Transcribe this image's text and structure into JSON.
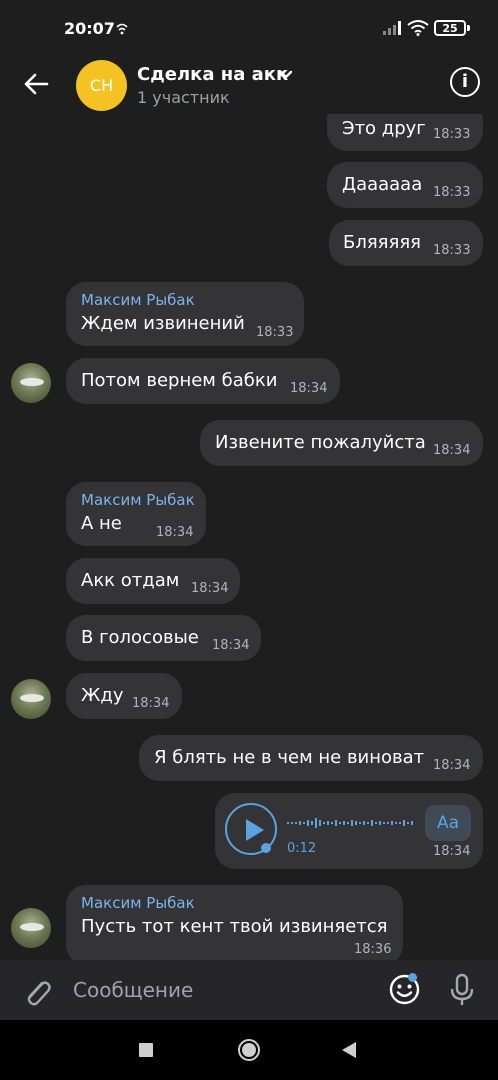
{
  "status_bar": {
    "time": "20:07",
    "battery": "25"
  },
  "header": {
    "avatar_initials": "CH",
    "title": "Сделка на акк",
    "subtitle": "1 участник"
  },
  "messages": [
    {
      "text": "Это друг",
      "time": "18:33",
      "outgoing": true
    },
    {
      "text": "Дааааaa",
      "time": "18:33",
      "outgoing": true
    },
    {
      "text": "Бляяяяя",
      "time": "18:33",
      "outgoing": true
    },
    {
      "sender": "Максим Рыбак",
      "text": "Ждем извинений",
      "time": "18:33",
      "outgoing": false
    },
    {
      "text": "Потом вернем бабки",
      "time": "18:34",
      "outgoing": false
    },
    {
      "text": "Извените пожалуйста",
      "time": "18:34",
      "outgoing": true
    },
    {
      "sender": "Максим Рыбак",
      "text": "А не",
      "time": "18:34",
      "outgoing": false
    },
    {
      "text": "Акк отдам",
      "time": "18:34",
      "outgoing": false
    },
    {
      "text": "В голосовые",
      "time": "18:34",
      "outgoing": false
    },
    {
      "text": "Жду",
      "time": "18:34",
      "outgoing": false
    },
    {
      "text": "Я блять не в чем не виноват",
      "time": "18:34",
      "outgoing": true
    },
    {
      "voice_duration": "0:12",
      "aa_label": "Aa",
      "time": "18:34",
      "outgoing": true
    },
    {
      "sender": "Максим Рыбак",
      "text": "Пусть тот кент твой извиняется",
      "time": "18:36",
      "outgoing": false
    }
  ],
  "input": {
    "placeholder": "Сообщение"
  },
  "colors": {
    "background": "#1e1e1f",
    "bubble": "#343437",
    "accent": "#5aa3e0",
    "sender_name": "#7ab4ee",
    "avatar": "#f4c323"
  },
  "icons": [
    "back-icon",
    "chevron-down-icon",
    "info-icon",
    "attach-icon",
    "emoji-icon",
    "mic-icon",
    "play-icon"
  ]
}
